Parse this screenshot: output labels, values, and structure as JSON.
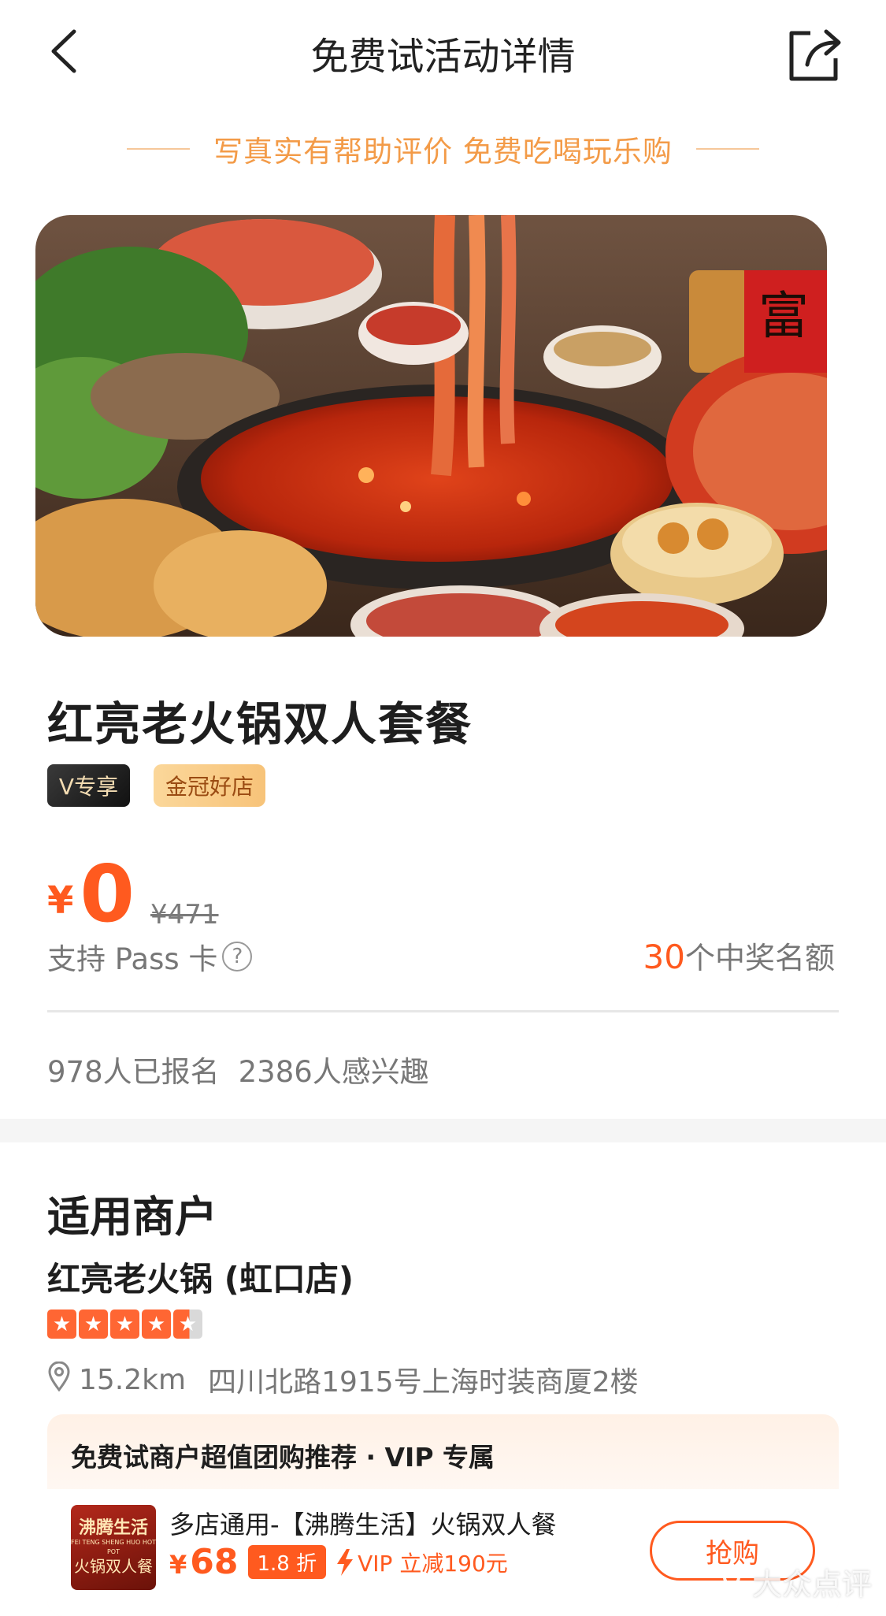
{
  "nav": {
    "title": "免费试活动详情"
  },
  "slogan": "写真实有帮助评价 免费吃喝玩乐购",
  "hero": {
    "calligraphy_char": "富"
  },
  "product": {
    "title": "红亮老火锅双人套餐",
    "tags": [
      "V专享",
      "金冠好店"
    ],
    "price_symbol": "¥",
    "price": "0",
    "original_price": "¥471",
    "pass_text": "支持 Pass 卡",
    "help_icon": "?",
    "quota_number": "30",
    "quota_text": "个中奖名额",
    "signed_up": "978人已报名",
    "interested": "2386人感兴趣"
  },
  "merchant": {
    "heading": "适用商户",
    "name": "红亮老火锅 (虹口店)",
    "rating_stars": 4.5,
    "distance": "15.2km",
    "address": "四川北路1915号上海时装商厦2楼"
  },
  "promo": {
    "title": "免费试商户超值团购推荐 · VIP 专属",
    "deal_name": "多店通用-【沸腾生活】火锅双人餐",
    "thumb_line1": "沸腾生活",
    "thumb_line2": "FEI TENG SHENG HUO HOT POT",
    "thumb_line3": "火锅双人餐",
    "price_symbol": "¥",
    "price": "68",
    "discount": "1.8 折",
    "vip_text": "VIP 立减190元",
    "buy_label": "抢购"
  },
  "watermark": "大众点评",
  "colors": {
    "accent": "#ff5a1f",
    "slogan": "#f39b48",
    "star": "#ff6633"
  },
  "icons": [
    "back-arrow-icon",
    "share-icon",
    "help-circle-icon",
    "location-pin-icon",
    "star-icon",
    "lightning-icon"
  ]
}
